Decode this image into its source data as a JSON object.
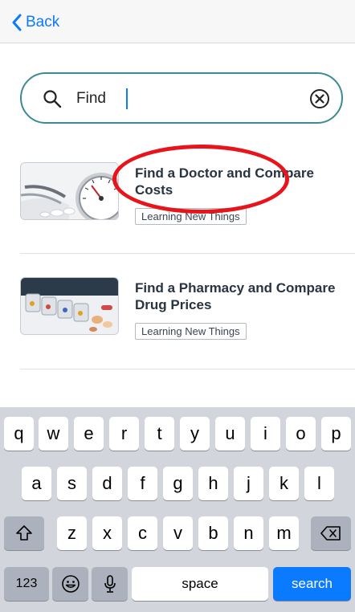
{
  "nav": {
    "back_label": "Back"
  },
  "search": {
    "value": "Find",
    "placeholder": ""
  },
  "results": [
    {
      "title": "Find a Doctor and Compare Costs",
      "tag": "Learning New Things",
      "thumb": "blood-pressure-gauge-image"
    },
    {
      "title": "Find a Pharmacy and Compare Drug Prices",
      "tag": "Learning New Things",
      "thumb": "pill-organizer-image"
    }
  ],
  "keyboard": {
    "row1": [
      "q",
      "w",
      "e",
      "r",
      "t",
      "y",
      "u",
      "i",
      "o",
      "p"
    ],
    "row2": [
      "a",
      "s",
      "d",
      "f",
      "g",
      "h",
      "j",
      "k",
      "l"
    ],
    "row3": [
      "z",
      "x",
      "c",
      "v",
      "b",
      "n",
      "m"
    ],
    "numbers_label": "123",
    "space_label": "space",
    "search_label": "search"
  },
  "icons": {
    "back": "chevron-left-icon",
    "search": "magnifier-icon",
    "clear": "circle-x-icon",
    "shift": "shift-arrow-icon",
    "delete": "backspace-icon",
    "emoji": "emoji-icon",
    "mic": "microphone-icon"
  },
  "colors": {
    "accent": "#0a7aff",
    "search_border": "#3c8a95",
    "highlight": "#e8141c"
  }
}
